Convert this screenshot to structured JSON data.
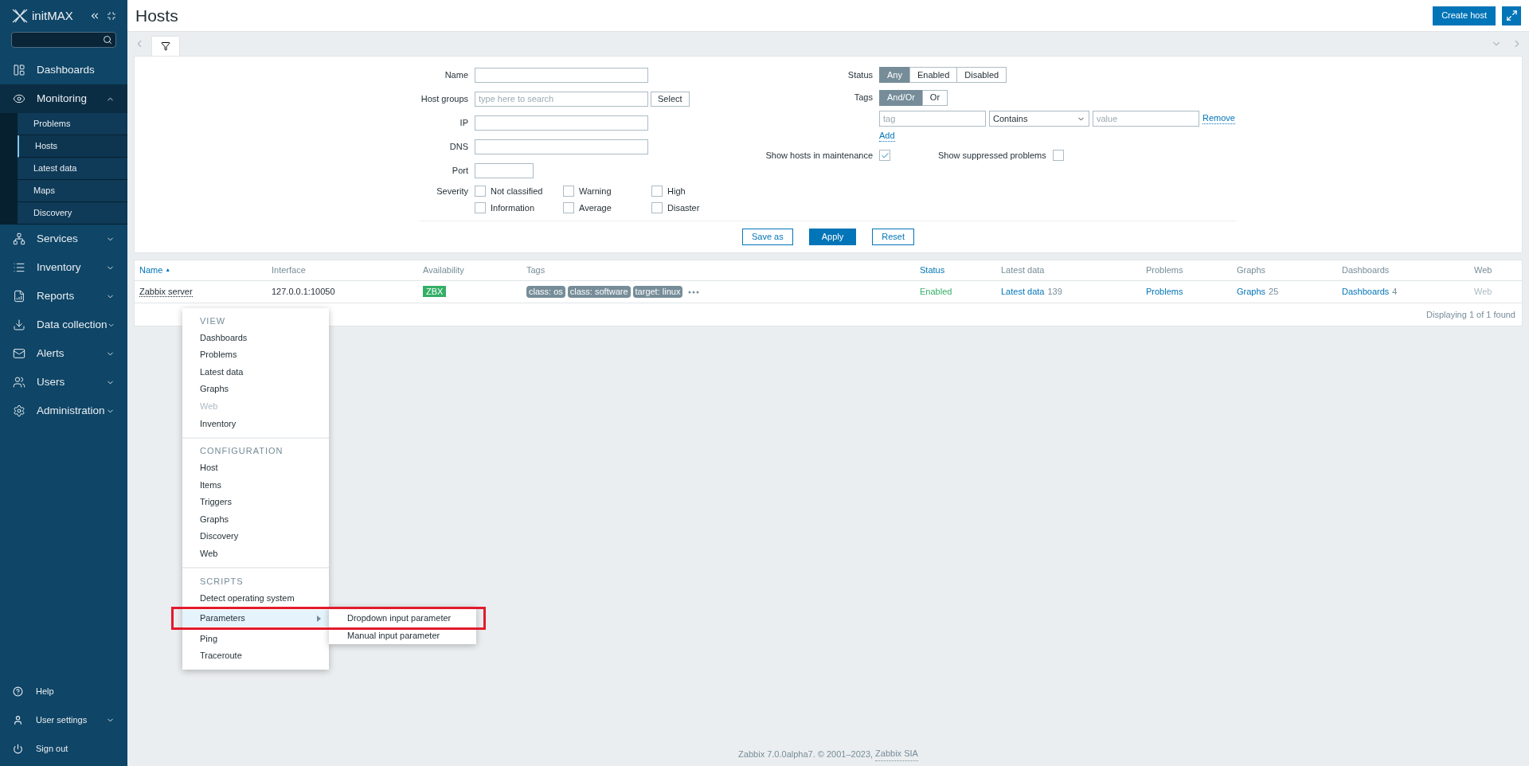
{
  "sidebar": {
    "logo": "initMAX",
    "items": [
      {
        "label": "Dashboards",
        "kind": "link"
      },
      {
        "label": "Monitoring",
        "kind": "group",
        "expanded": true,
        "children": [
          {
            "label": "Problems",
            "selected": false
          },
          {
            "label": "Hosts",
            "selected": true
          },
          {
            "label": "Latest data",
            "selected": false
          },
          {
            "label": "Maps",
            "selected": false
          },
          {
            "label": "Discovery",
            "selected": false
          }
        ]
      },
      {
        "label": "Services",
        "kind": "group",
        "expanded": false
      },
      {
        "label": "Inventory",
        "kind": "group",
        "expanded": false
      },
      {
        "label": "Reports",
        "kind": "group",
        "expanded": false
      },
      {
        "label": "Data collection",
        "kind": "group",
        "expanded": false
      },
      {
        "label": "Alerts",
        "kind": "group",
        "expanded": false
      },
      {
        "label": "Users",
        "kind": "group",
        "expanded": false
      },
      {
        "label": "Administration",
        "kind": "group",
        "expanded": false
      }
    ],
    "bottom": [
      {
        "label": "Help",
        "kind": "link"
      },
      {
        "label": "User settings",
        "kind": "group",
        "expanded": false
      },
      {
        "label": "Sign out",
        "kind": "link"
      }
    ]
  },
  "header": {
    "title": "Hosts",
    "create_button": "Create host"
  },
  "filter": {
    "fields": [
      {
        "label": "Name",
        "kind": "text"
      },
      {
        "label": "Host groups",
        "kind": "multiselect",
        "placeholder": "type here to search",
        "button": "Select"
      },
      {
        "label": "IP",
        "kind": "text"
      },
      {
        "label": "DNS",
        "kind": "text"
      },
      {
        "label": "Port",
        "kind": "short"
      }
    ],
    "severity": {
      "label": "Severity",
      "options": [
        {
          "label": "Not classified",
          "checked": false
        },
        {
          "label": "Information",
          "checked": false
        },
        {
          "label": "Warning",
          "checked": false
        },
        {
          "label": "Average",
          "checked": false
        },
        {
          "label": "High",
          "checked": false
        },
        {
          "label": "Disaster",
          "checked": false
        }
      ]
    },
    "status": {
      "label": "Status",
      "options": [
        {
          "label": "Any",
          "selected": true
        },
        {
          "label": "Enabled",
          "selected": false
        },
        {
          "label": "Disabled",
          "selected": false
        }
      ]
    },
    "tags": {
      "label": "Tags",
      "operators": [
        {
          "label": "And/Or",
          "selected": true
        },
        {
          "label": "Or",
          "selected": false
        }
      ],
      "tag_placeholder": "tag",
      "condition": "Contains",
      "value_placeholder": "value",
      "remove": "Remove",
      "add": "Add"
    },
    "maintenance": {
      "label": "Show hosts in maintenance",
      "checked": true
    },
    "suppressed": {
      "label": "Show suppressed problems",
      "checked": false
    },
    "buttons": [
      {
        "label": "Save as",
        "kind": "secondary"
      },
      {
        "label": "Apply",
        "kind": "primary"
      },
      {
        "label": "Reset",
        "kind": "secondary"
      }
    ]
  },
  "table": {
    "columns": [
      {
        "label": "Name",
        "sort": "▲",
        "link": true
      },
      {
        "label": "Interface",
        "link": false
      },
      {
        "label": "Availability",
        "link": false
      },
      {
        "label": "Tags",
        "link": false
      },
      {
        "label": "Status",
        "link": true
      },
      {
        "label": "Latest data",
        "link": false
      },
      {
        "label": "Problems",
        "link": false
      },
      {
        "label": "Graphs",
        "link": false
      },
      {
        "label": "Dashboards",
        "link": false
      },
      {
        "label": "Web",
        "link": false
      }
    ],
    "rows": [
      {
        "name": "Zabbix server",
        "interface": "127.0.0.1:10050",
        "availability": "ZBX",
        "tags": [
          "class: os",
          "class: software",
          "target: linux"
        ],
        "status": "Enabled",
        "latest_data": {
          "label": "Latest data",
          "count": "139"
        },
        "problems": "Problems",
        "graphs": {
          "label": "Graphs",
          "count": "25"
        },
        "dashboards": {
          "label": "Dashboards",
          "count": "4"
        },
        "web": "Web"
      }
    ],
    "footer": "Displaying 1 of 1 found"
  },
  "context_menu": {
    "sections": [
      {
        "title": "VIEW",
        "items": [
          {
            "label": "Dashboards",
            "disabled": false,
            "selected": false
          },
          {
            "label": "Problems",
            "disabled": false,
            "selected": false
          },
          {
            "label": "Latest data",
            "disabled": false,
            "selected": false
          },
          {
            "label": "Graphs",
            "disabled": false,
            "selected": false
          },
          {
            "label": "Web",
            "disabled": true,
            "selected": false
          },
          {
            "label": "Inventory",
            "disabled": false,
            "selected": false
          }
        ]
      },
      {
        "title": "CONFIGURATION",
        "items": [
          {
            "label": "Host",
            "disabled": false,
            "selected": false
          },
          {
            "label": "Items",
            "disabled": false,
            "selected": false
          },
          {
            "label": "Triggers",
            "disabled": false,
            "selected": false
          },
          {
            "label": "Graphs",
            "disabled": false,
            "selected": false
          },
          {
            "label": "Discovery",
            "disabled": false,
            "selected": false
          },
          {
            "label": "Web",
            "disabled": false,
            "selected": false
          }
        ]
      },
      {
        "title": "SCRIPTS",
        "items": [
          {
            "label": "Detect operating system",
            "disabled": false,
            "selected": false
          },
          {
            "label": "Parameters",
            "disabled": false,
            "selected": true,
            "submenu": [
              "Dropdown input parameter",
              "Manual input parameter"
            ]
          },
          {
            "label": "Ping",
            "disabled": false,
            "selected": false
          },
          {
            "label": "Traceroute",
            "disabled": false,
            "selected": false
          }
        ]
      }
    ]
  },
  "footer": {
    "text": "Zabbix 7.0.0alpha7. © 2001–2023, ",
    "link": "Zabbix SIA"
  }
}
